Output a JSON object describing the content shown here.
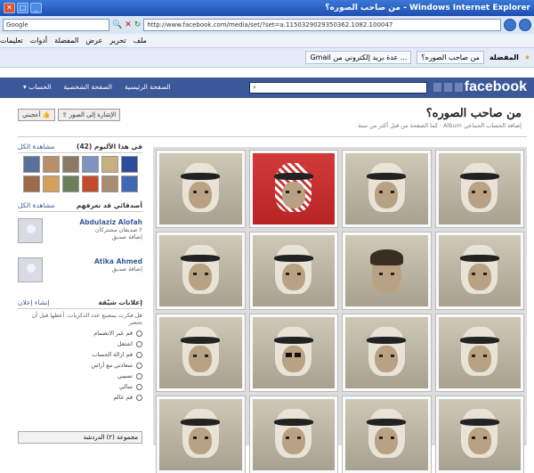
{
  "browser": {
    "title": "من صاحب الصوره؟ - Windows Internet Explorer",
    "address": "http://www.facebook.com/media/set/?set=a.1150329029350362.1082.100047",
    "search_placeholder": "Google",
    "menu": [
      "ملف",
      "تحرير",
      "عرض",
      "المفضلة",
      "أدوات",
      "تعليمات"
    ],
    "fav_label": "المفضلة",
    "tabs": [
      "من صاحب الصوره؟",
      "Gmail عدة بريد إلكتروني من ..."
    ]
  },
  "fb": {
    "logo": "facebook",
    "nav": [
      "الصفحة الرئيسية",
      "الصفحة الشخصية",
      "الحساب ▾"
    ]
  },
  "page": {
    "title": "من صاحب الصوره؟",
    "subtitle": "إضافة الحساب الجماعي Album · كما الصفحة من قبل أكثر من سنة",
    "buttons": [
      "⇪ الإشارة إلى الصور",
      "أعجبني 👍"
    ]
  },
  "sidebar": {
    "album_header": "في هذا الألبوم (42)",
    "album_link": "مشاهدة الكل",
    "friends_header": "أصدقائي قد تعرفهم",
    "friends_link": "مشاهدة الكل",
    "friends": [
      {
        "name": "Abdulaziz Alofah",
        "meta": "٢ صديقان مشتركان",
        "action": "إضافة صديق"
      },
      {
        "name": "Atika Ahmed",
        "meta": "إضافة صديق"
      }
    ],
    "ads_header": "إعلانات شيّقة",
    "ads_link": "إنشاء إعلان",
    "ads_text": "هل فكرت بمصنع عدد الذكريات، أعطها قبل أن تحضر",
    "options": [
      "قم عبر الانضمام",
      "اشتغل",
      "قم ازالة الحساب",
      "سعادتي مع أراس",
      "نسيبي",
      "سالي",
      "قم عالم"
    ],
    "bottom": "مجموعة (٢) الدردشة"
  }
}
